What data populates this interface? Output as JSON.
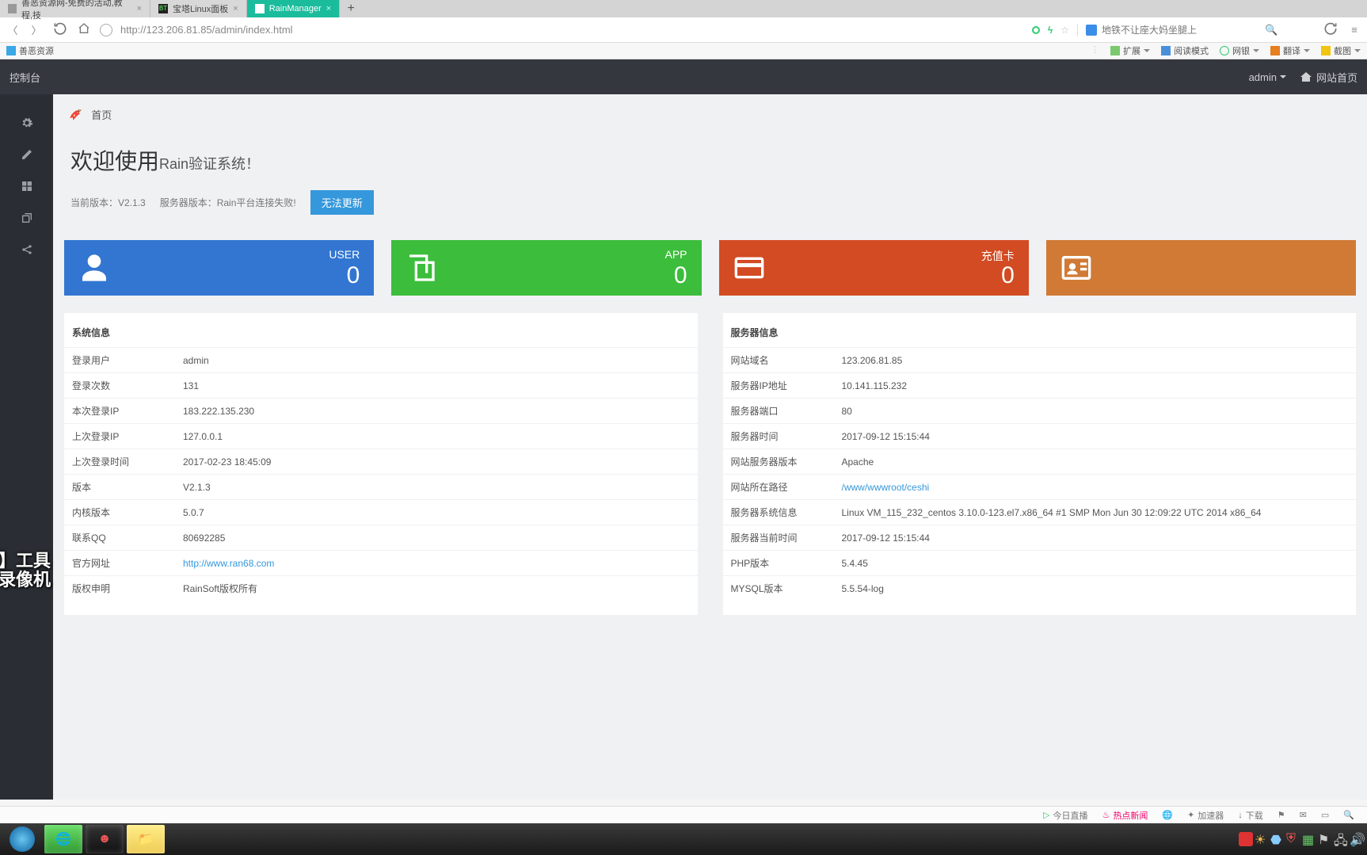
{
  "browser": {
    "tabs": [
      {
        "title": "善恶资源网-免费的活动,教程,技",
        "active": false
      },
      {
        "title": "宝塔Linux面板",
        "active": false
      },
      {
        "title": "RainManager",
        "active": true
      }
    ],
    "url": "http://123.206.81.85/admin/index.html",
    "search_placeholder": "地铁不让座大妈坐腿上",
    "bookmarks": {
      "left": "善恶资源"
    },
    "ext": {
      "expand": "扩展",
      "read": "阅读模式",
      "net": "网银",
      "trans": "翻译",
      "shot": "截图"
    },
    "bottom": {
      "live": "今日直播",
      "hot": "热点新闻",
      "accel": "加速器",
      "download": "下载"
    }
  },
  "header": {
    "brand": "控制台",
    "user": "admin",
    "site_home": "网站首页"
  },
  "breadcrumb": {
    "home": "首页"
  },
  "hero": {
    "title_main": "欢迎使用",
    "title_sub": "Rain验证系统！",
    "version_label": "当前版本：V2.1.3",
    "server_label": "服务器版本：Rain平台连接失败!",
    "update_btn": "无法更新"
  },
  "cards": {
    "user": {
      "label": "USER",
      "value": "0"
    },
    "app": {
      "label": "APP",
      "value": "0"
    },
    "recharge": {
      "label": "充值卡",
      "value": "0"
    },
    "fourth": {
      "label": "",
      "value": ""
    }
  },
  "sysinfo": {
    "title": "系统信息",
    "rows": [
      {
        "k": "登录用户",
        "v": "admin"
      },
      {
        "k": "登录次数",
        "v": "131"
      },
      {
        "k": "本次登录IP",
        "v": "183.222.135.230"
      },
      {
        "k": "上次登录IP",
        "v": "127.0.0.1"
      },
      {
        "k": "上次登录时间",
        "v": "2017-02-23 18:45:09"
      },
      {
        "k": "版本",
        "v": "V2.1.3"
      },
      {
        "k": "内核版本",
        "v": "5.0.7"
      },
      {
        "k": "联系QQ",
        "v": "80692285"
      },
      {
        "k": "官方网址",
        "v": "http://www.ran68.com",
        "link": true
      },
      {
        "k": "版权申明",
        "v": "RainSoft版权所有"
      }
    ]
  },
  "srvinfo": {
    "title": "服务器信息",
    "rows": [
      {
        "k": "网站域名",
        "v": "123.206.81.85"
      },
      {
        "k": "服务器IP地址",
        "v": "10.141.115.232"
      },
      {
        "k": "服务器端口",
        "v": "80"
      },
      {
        "k": "服务器时间",
        "v": "2017-09-12 15:15:44"
      },
      {
        "k": "网站服务器版本",
        "v": "Apache"
      },
      {
        "k": "网站所在路径",
        "v": "/www/wwwroot/ceshi",
        "link": true
      },
      {
        "k": "服务器系统信息",
        "v": "Linux VM_115_232_centos 3.10.0-123.el7.x86_64 #1 SMP Mon Jun 30 12:09:22 UTC 2014 x86_64"
      },
      {
        "k": "服务器当前时间",
        "v": "2017-09-12 15:15:44"
      },
      {
        "k": "PHP版本",
        "v": "5.4.45"
      },
      {
        "k": "MYSQL版本",
        "v": "5.5.54-log"
      }
    ]
  },
  "watermark": {
    "l1": "】工具",
    "l2": "录像机"
  }
}
